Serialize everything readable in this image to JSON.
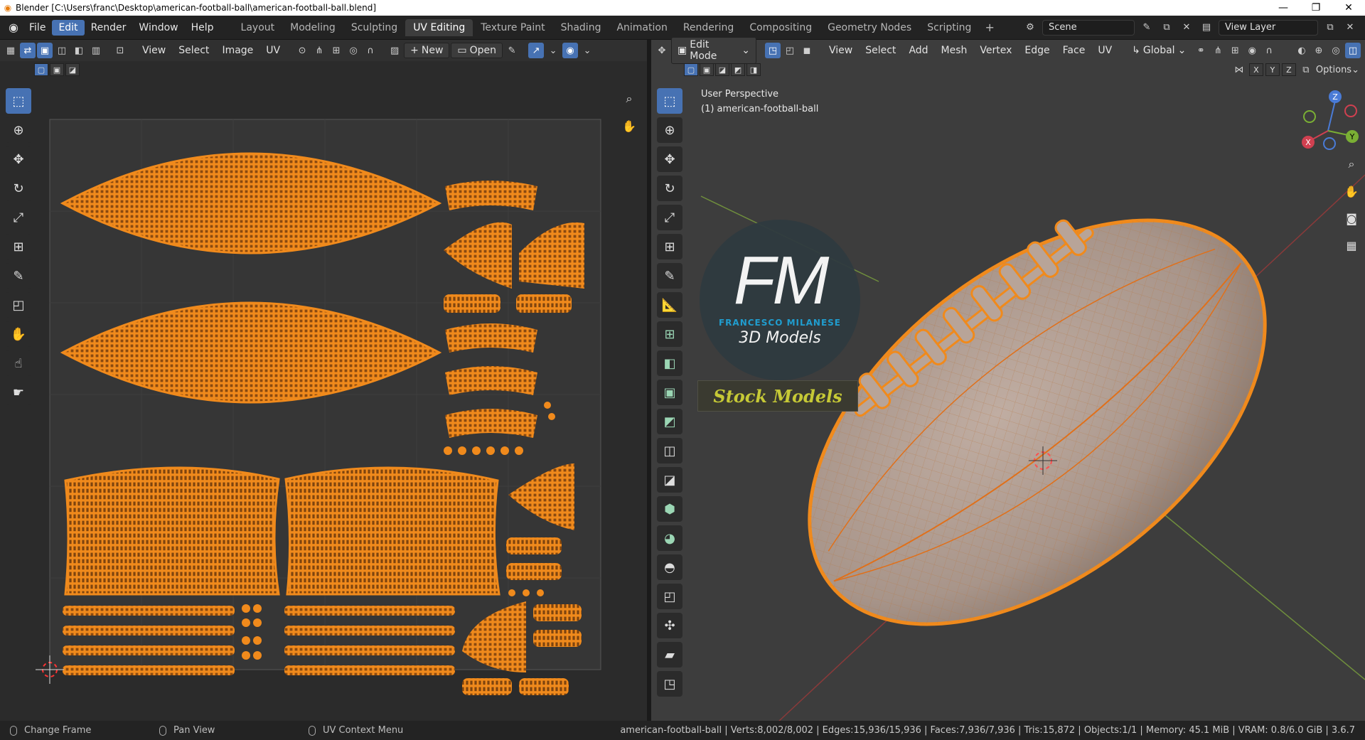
{
  "window": {
    "title": "Blender [C:\\Users\\franc\\Desktop\\american-football-ball\\american-football-ball.blend]",
    "controls": [
      "—",
      "❐",
      "✕"
    ]
  },
  "menus": [
    "File",
    "Edit",
    "Render",
    "Window",
    "Help"
  ],
  "workspaces": [
    "Layout",
    "Modeling",
    "Sculpting",
    "UV Editing",
    "Texture Paint",
    "Shading",
    "Animation",
    "Rendering",
    "Compositing",
    "Geometry Nodes",
    "Scripting"
  ],
  "active_workspace": "UV Editing",
  "scene": {
    "name": "Scene",
    "view_layer": "View Layer"
  },
  "uv_editor": {
    "menus": [
      "View",
      "Select",
      "Image",
      "UV"
    ],
    "new_label": "New",
    "open_label": "Open"
  },
  "viewport": {
    "mode": "Edit Mode",
    "menus": [
      "View",
      "Select",
      "Add",
      "Mesh",
      "Vertex",
      "Edge",
      "Face",
      "UV"
    ],
    "orientation": "Global",
    "axes": [
      "X",
      "Y",
      "Z"
    ],
    "options_label": "Options",
    "overlay_line1": "User Perspective",
    "overlay_line2": "(1) american-football-ball",
    "gizmo": {
      "x": "X",
      "y": "Y",
      "z": "Z"
    }
  },
  "watermark": {
    "logo": "FM",
    "brand": "FRANCESCO MILANESE",
    "tag": "3D Models",
    "badge": "Stock Models"
  },
  "statusbar": {
    "items": [
      "Change Frame",
      "Pan View",
      "UV Context Menu"
    ],
    "stats": "american-football-ball | Verts:8,002/8,002 | Edges:15,936/15,936 | Faces:7,936/7,936 | Tris:15,872 | Objects:1/1 | Memory: 45.1 MiB | VRAM: 0.8/6.0 GiB | 3.6.7"
  },
  "colors": {
    "accent": "#4772b3",
    "uv_orange": "#f08a1c",
    "ball": "#a8958a",
    "badge_text": "#c6c936",
    "fm_blue": "#1fa3d8"
  }
}
